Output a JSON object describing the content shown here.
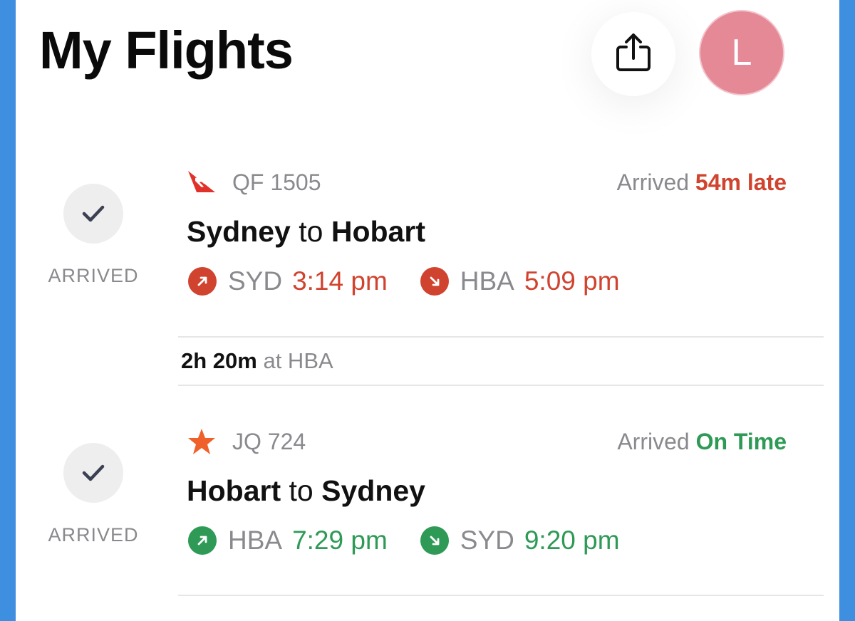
{
  "header": {
    "title": "My Flights",
    "avatar_initial": "L"
  },
  "colors": {
    "late": "#d0432f",
    "on_time": "#2e9a56",
    "muted": "#8a8a8e",
    "background_blue": "#3f8fe0",
    "avatar": "#e58997"
  },
  "flights": [
    {
      "status_label": "ARRIVED",
      "airline_icon": "qantas-kangaroo-icon",
      "flight_number": "QF 1505",
      "status_prefix": "Arrived",
      "status_value": "54m late",
      "origin_city": "Sydney",
      "connector": "to",
      "destination_city": "Hobart",
      "depart_code": "SYD",
      "depart_time": "3:14 pm",
      "arrive_code": "HBA",
      "arrive_time": "5:09 pm"
    },
    {
      "status_label": "ARRIVED",
      "airline_icon": "jetstar-star-icon",
      "flight_number": "JQ 724",
      "status_prefix": "Arrived",
      "status_value": "On Time",
      "origin_city": "Hobart",
      "connector": "to",
      "destination_city": "Sydney",
      "depart_code": "HBA",
      "depart_time": "7:29 pm",
      "arrive_code": "SYD",
      "arrive_time": "9:20 pm"
    }
  ],
  "layover": {
    "duration": "2h 20m",
    "location_text": "at HBA"
  }
}
